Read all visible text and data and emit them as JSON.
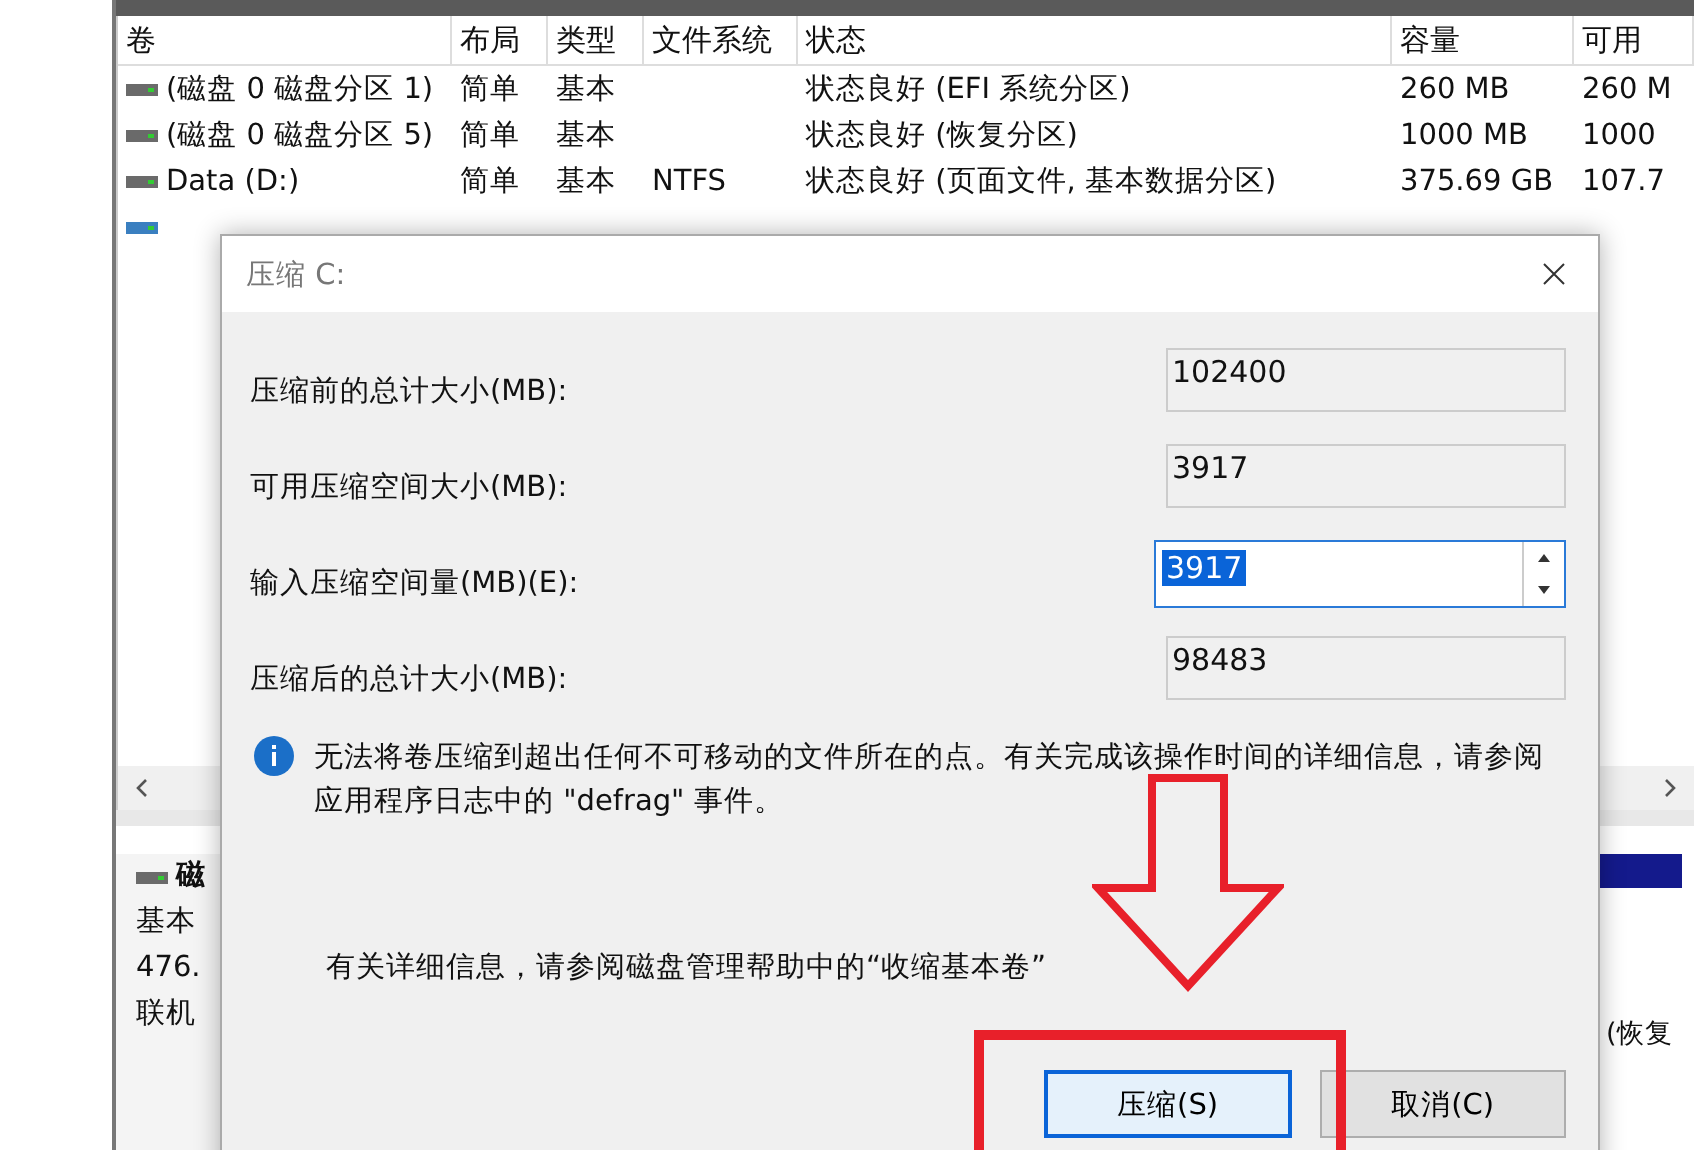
{
  "table": {
    "columns": [
      "卷",
      "布局",
      "类型",
      "文件系统",
      "状态",
      "容量",
      "可用"
    ],
    "rows": [
      {
        "cells": [
          "(磁盘 0 磁盘分区 1)",
          "简单",
          "基本",
          "",
          "状态良好 (EFI 系统分区)",
          "260 MB",
          "260 M"
        ],
        "kind": "disk"
      },
      {
        "cells": [
          "(磁盘 0 磁盘分区 5)",
          "简单",
          "基本",
          "",
          "状态良好 (恢复分区)",
          "1000 MB",
          "1000"
        ],
        "kind": "disk"
      },
      {
        "cells": [
          "Data (D:)",
          "简单",
          "基本",
          "NTFS",
          "状态良好 (页面文件, 基本数据分区)",
          "375.69 GB",
          "107.7"
        ],
        "kind": "disk"
      },
      {
        "cells": [],
        "kind": "system"
      }
    ]
  },
  "disk_panel": {
    "name": "磁",
    "lines": [
      "基本",
      "476.",
      "联机"
    ],
    "partition_text": "(恢复"
  },
  "dialog": {
    "title": "压缩 C:",
    "fields": [
      {
        "label": "压缩前的总计大小(MB):",
        "value": "102400",
        "kind": "readonly"
      },
      {
        "label": "可用压缩空间大小(MB):",
        "value": "3917",
        "kind": "readonly"
      },
      {
        "label": "输入压缩空间量(MB)(E):",
        "value": "3917",
        "kind": "spin"
      },
      {
        "label": "压缩后的总计大小(MB):",
        "value": "98483",
        "kind": "readonly"
      }
    ],
    "info": "无法将卷压缩到超出任何不可移动的文件所在的点。有关完成该操作时间的详细信息，请参阅应用程序日志中的 \"defrag\" 事件。",
    "help": "有关详细信息，请参阅磁盘管理帮助中的“收缩基本卷”",
    "buttons": [
      "压缩(S)",
      "取消(C)"
    ]
  }
}
